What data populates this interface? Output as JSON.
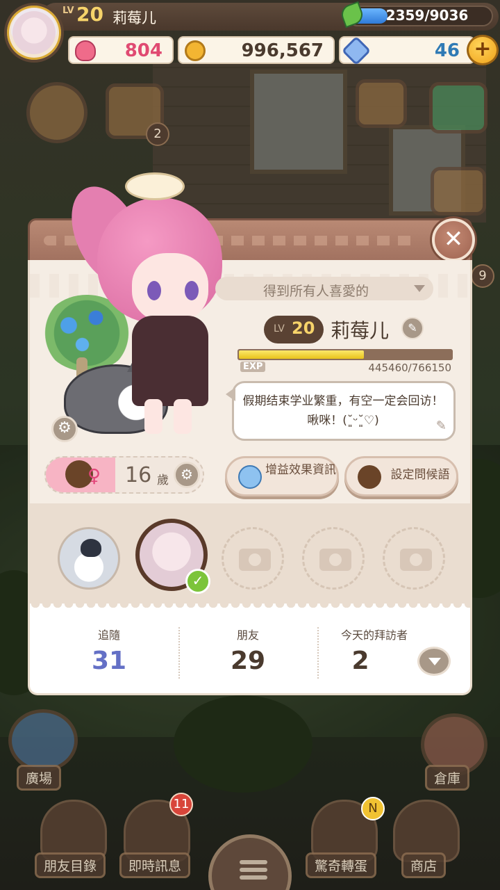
{
  "player": {
    "level_prefix": "LV",
    "level": "20",
    "name": "莉莓儿",
    "xp_text": "2359/9036",
    "xp_fraction": 0.26
  },
  "currency": {
    "hearts": "804",
    "coins": "996,567",
    "gems": "46",
    "add_label": "+"
  },
  "world": {
    "quest_badge": "2",
    "side_badge": "9",
    "plaza_label": "廣場",
    "warehouse_label": "倉庫",
    "nav": {
      "friends_label": "朋友目錄",
      "messages_label": "即時訊息",
      "messages_badge": "11",
      "gacha_label": "驚奇轉蛋",
      "gacha_badge": "N",
      "shop_label": "商店"
    }
  },
  "profile": {
    "close_label": "✕",
    "status": "得到所有人喜愛的",
    "level_prefix": "LV",
    "level": "20",
    "name": "莉莓儿",
    "exp_label": "EXP",
    "exp_text": "445460/766150",
    "exp_fraction": 0.58,
    "greeting": "假期结束学业繁重，有空一定会回访！啾咪！(˘͈ᵕ˘͈♡)",
    "age_value": "16",
    "age_unit": "歲",
    "gender_symbol": "♀",
    "buff_button_label": "增益效果資訊",
    "greet_button_label": "設定問候語",
    "stats": {
      "following_label": "追隨",
      "following_value": "31",
      "friends_label": "朋友",
      "friends_value": "29",
      "visitors_label": "今天的拜訪者",
      "visitors_value": "2"
    }
  },
  "colors": {
    "accent_gold": "#f6d36a",
    "following_blue": "#6470c6",
    "heart_pink": "#e04a72",
    "gem_blue": "#2f7ab5",
    "dialog_header": "#a27260"
  }
}
